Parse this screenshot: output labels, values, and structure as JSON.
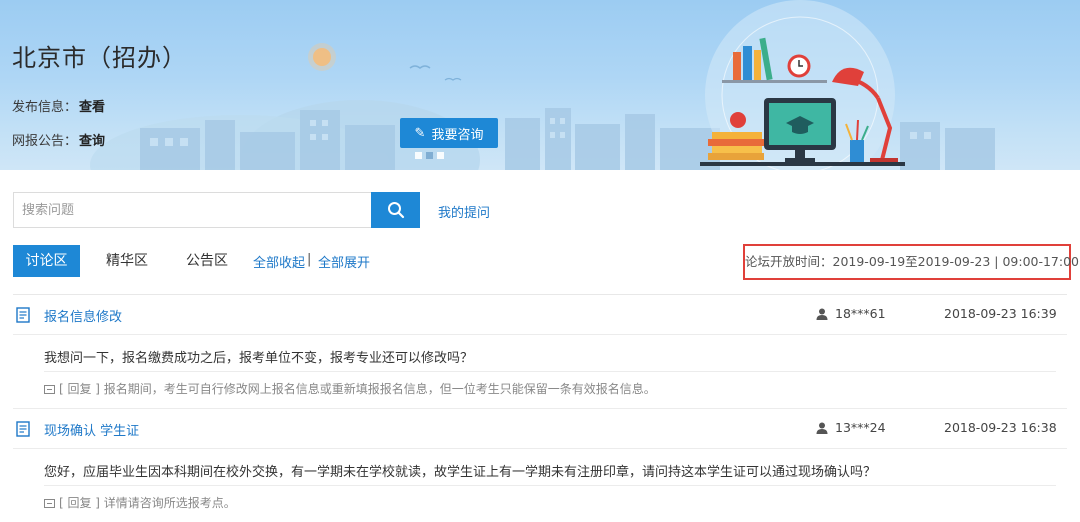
{
  "banner": {
    "title": "北京市（招办）",
    "publish_label": "发布信息：",
    "publish_link": "查看",
    "exam_label": "网报公告：",
    "exam_link": "查询",
    "consult_button": "我要咨询"
  },
  "search": {
    "placeholder": "搜索问题",
    "my_questions": "我的提问"
  },
  "tabs": {
    "discussion": "讨论区",
    "featured": "精华区",
    "notice": "公告区",
    "collapse_all": "全部收起",
    "separator": "|",
    "expand_all": "全部展开"
  },
  "forum_time": "论坛开放时间：2019-09-19至2019-09-23 | 09:00-17:00",
  "posts": [
    {
      "title": "报名信息修改",
      "user": "18***61",
      "time": "2018-09-23 16:39",
      "question": "我想问一下，报名缴费成功之后，报考单位不变，报考专业还可以修改吗？",
      "reply": "[ 回复 ] 报名期间，考生可自行修改网上报名信息或重新填报报名信息，但一位考生只能保留一条有效报名信息。"
    },
    {
      "title": "现场确认 学生证",
      "user": "13***24",
      "time": "2018-09-23 16:38",
      "question": "您好，应届毕业生因本科期间在校外交换，有一学期未在学校就读，故学生证上有一学期未有注册印章，请问持这本学生证可以通过现场确认吗？",
      "reply": "[ 回复 ] 详情请咨询所选报考点。"
    }
  ],
  "colors": {
    "accent": "#1e88d6",
    "link": "#1e78c8",
    "highlight_border": "#e0403a"
  }
}
